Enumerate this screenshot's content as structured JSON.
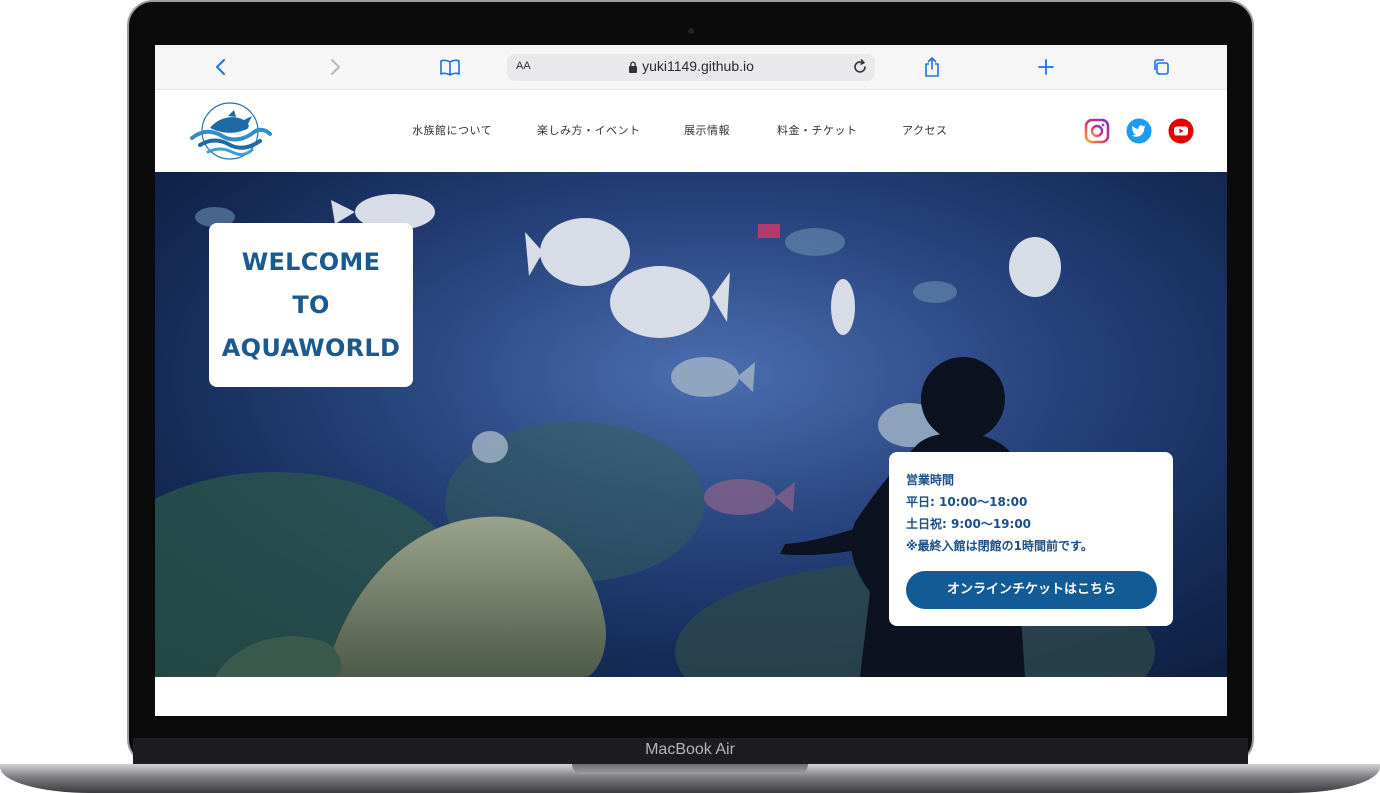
{
  "browser": {
    "text_size_label": "AA",
    "url": "yuki1149.github.io"
  },
  "nav": {
    "items": [
      {
        "label": "水族館について"
      },
      {
        "label": "楽しみ方・イベント"
      },
      {
        "label": "展示情報"
      },
      {
        "label": "料金・チケット"
      },
      {
        "label": "アクセス"
      }
    ]
  },
  "hero": {
    "welcome_lines": [
      "WELCOME",
      "TO",
      "AQUAWORLD"
    ]
  },
  "hours": {
    "title": "営業時間",
    "weekday": "平日: 10:00～18:00",
    "weekend": "土日祝: 9:00～19:00",
    "note": "※最終入館は閉館の1時間前です。",
    "ticket_button": "オンラインチケットはこちら"
  },
  "device": {
    "model": "MacBook Air"
  },
  "colors": {
    "brand_blue": "#1b5a8f",
    "button_blue": "#135b97",
    "browser_accent": "#1a73e8"
  },
  "icons": {
    "social": [
      "instagram-icon",
      "twitter-icon",
      "youtube-icon"
    ]
  }
}
